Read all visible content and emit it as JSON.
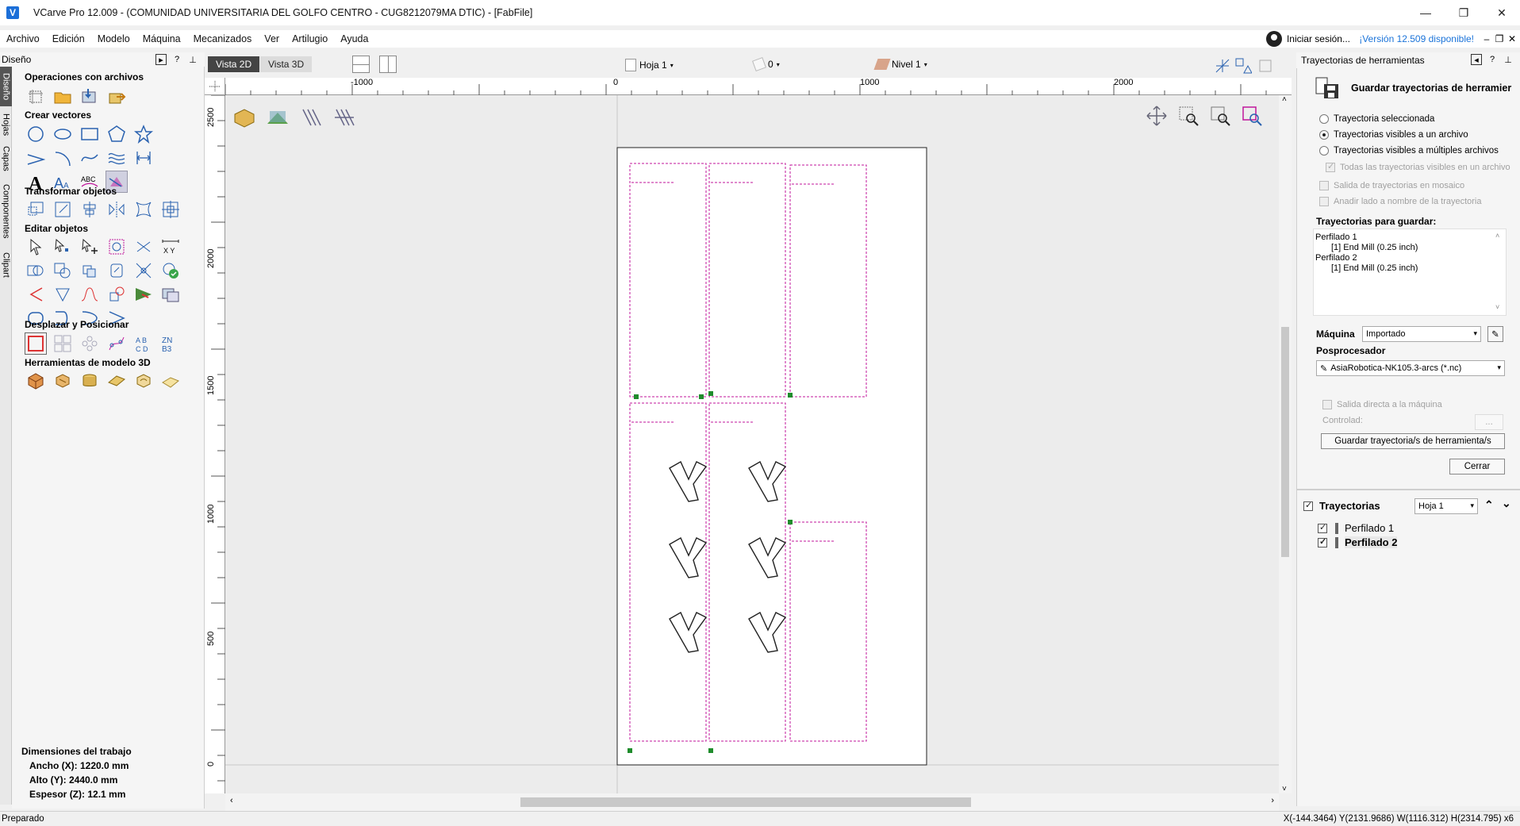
{
  "window": {
    "title": "VCarve Pro 12.009 - (COMUNIDAD UNIVERSITARIA DEL GOLFO CENTRO - CUG8212079MA DTIC) - [FabFile]",
    "logo_letter": "V"
  },
  "menu": [
    "Archivo",
    "Edición",
    "Modelo",
    "Máquina",
    "Mecanizados",
    "Ver",
    "Artilugio",
    "Ayuda"
  ],
  "account": {
    "signin": "Iniciar sesión...",
    "version": "¡Versión 12.509 disponible!"
  },
  "left_tabs": [
    "Diseño",
    "Hojas",
    "Capas",
    "Componentes",
    "Clipart"
  ],
  "design_panel": {
    "header": "Diseño",
    "sections": {
      "file_ops": "Operaciones con archivos",
      "create_vectors": "Crear vectores",
      "transform": "Transformar objetos",
      "edit": "Editar objetos",
      "move_position": "Desplazar y Posicionar",
      "model3d": "Herramientas de modelo 3D"
    },
    "job_dimensions": {
      "title": "Dimensiones del trabajo",
      "width": "Ancho   (X): 1220.0 mm",
      "height": "Alto   (Y): 2440.0 mm",
      "thickness": "Espesor (Z): 12.1 mm"
    }
  },
  "view_toolbar": {
    "tab_2d": "Vista 2D",
    "tab_3d": "Vista 3D",
    "sheet": "Hoja 1",
    "zero": "0",
    "level": "Nivel 1"
  },
  "rulers": {
    "top": [
      "-1000",
      "0",
      "1000",
      "2000"
    ],
    "left": [
      "2500",
      "2000",
      "1500",
      "1000",
      "500",
      "0"
    ]
  },
  "right_panel": {
    "header": "Trayectorias de herramientas",
    "title": "Guardar trayectorias de herramier",
    "radio_selected": "Trayectoria seleccionada",
    "radio_visible_one": "Trayectorias visibles a un archivo",
    "radio_visible_multi": "Trayectorias visibles a múltiples archivos",
    "chk_all_visible": "Todas las trayectorias visibles en un archivo",
    "chk_mosaic": "Salida de trayectorias en mosaico",
    "chk_add_side": "Anadir lado a nombre de la trayectoria",
    "to_save_label": "Trayectorias para guardar:",
    "to_save_list": [
      {
        "name": "Perfilado 1",
        "tool": "[1] End Mill (0.25 inch)"
      },
      {
        "name": "Perfilado 2",
        "tool": "[1] End Mill (0.25 inch)"
      }
    ],
    "machine_label": "Máquina",
    "machine_value": "Importado",
    "postprocessor_label": "Posprocesador",
    "postprocessor_value": "AsiaRobotica-NK105.3-arcs (*.nc)",
    "direct_output": "Salida directa a la máquina",
    "controlled": "Controlad:",
    "controlled_btn": "...",
    "save_button": "Guardar trayectoria/s de herramienta/s",
    "close_button": "Cerrar"
  },
  "toolpaths_panel": {
    "title": "Trayectorias",
    "sheet": "Hoja 1",
    "items": [
      "Perfilado 1",
      "Perfilado 2"
    ]
  },
  "status": {
    "left": "Preparado",
    "right": "X(-144.3464) Y(2131.9686)   W(1116.312) H(2314.795) x6"
  },
  "colors": {
    "toolpath": "#c0169b",
    "accent": "#1a73d9",
    "node": "#1f8c2c"
  }
}
